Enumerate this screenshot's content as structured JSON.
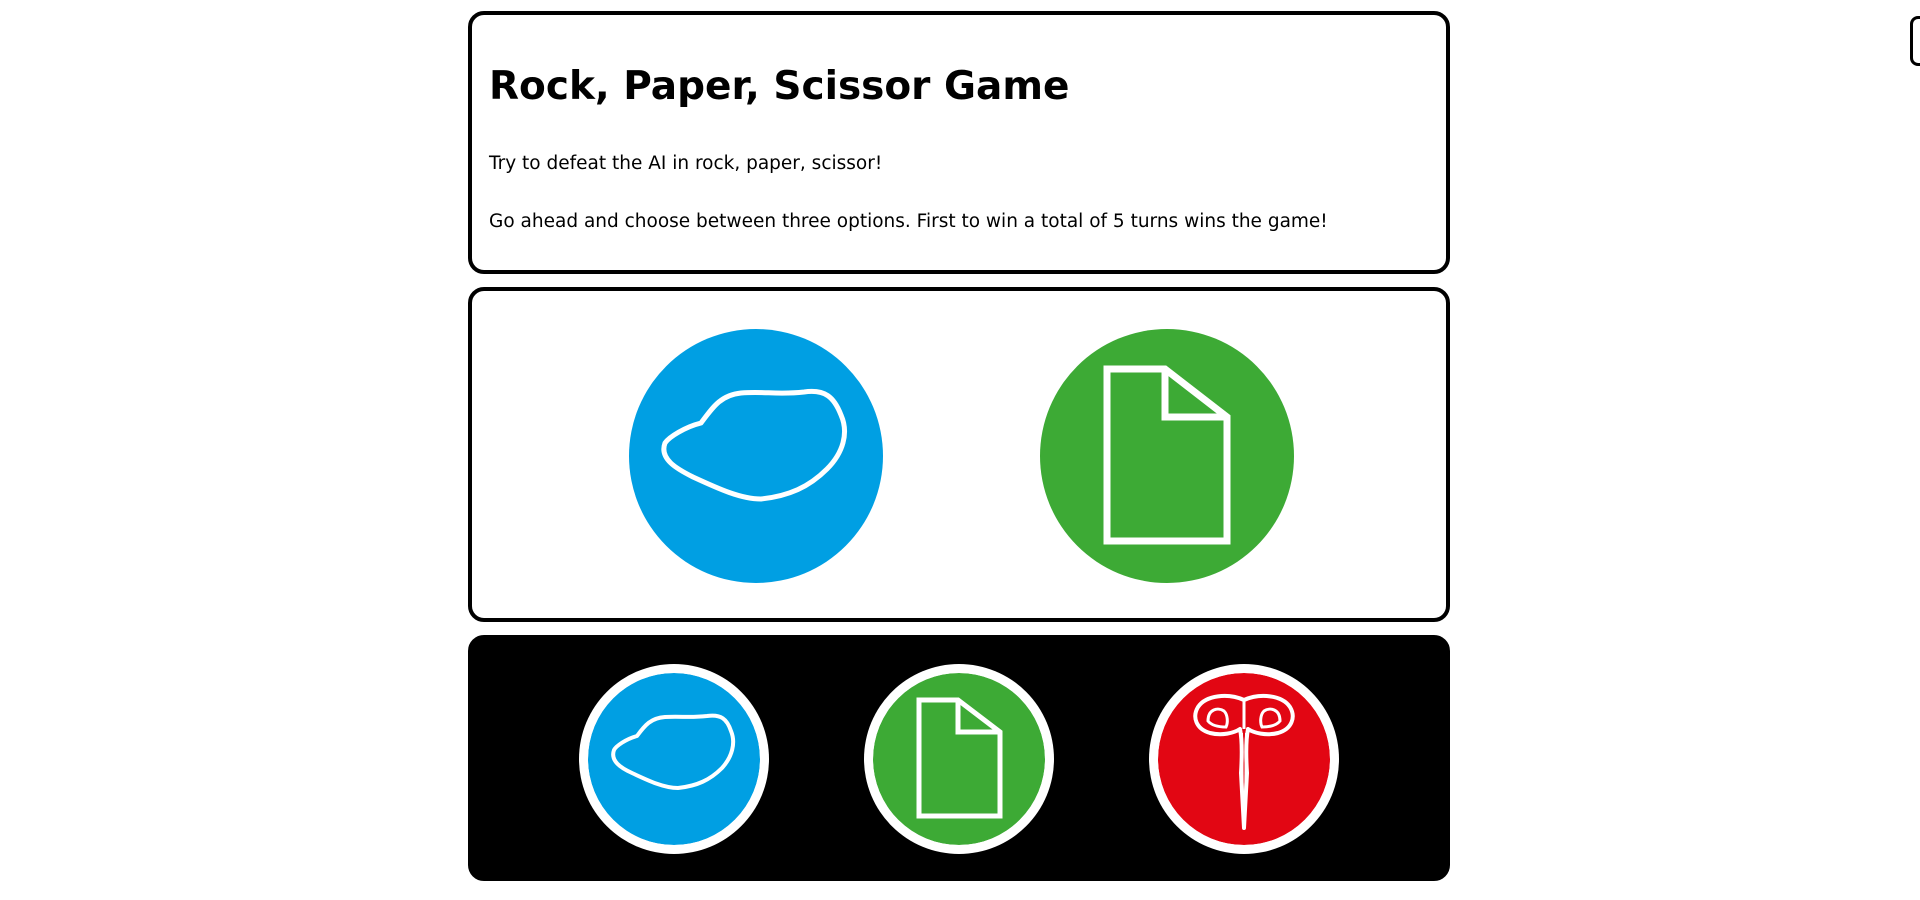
{
  "intro": {
    "title": "Rock, Paper, Scissor Game",
    "line1": "Try to defeat the AI in rock, paper, scissor!",
    "line2": "Go ahead and choose between three options. First to win a total of 5 turns wins the game!"
  },
  "arena": {
    "player_choice": {
      "name": "rock",
      "icon": "rock-icon",
      "color": "#009FE3"
    },
    "ai_choice": {
      "name": "paper",
      "icon": "paper-icon",
      "color": "#3DAA35"
    }
  },
  "controls": {
    "options": [
      {
        "name": "rock",
        "icon": "rock-icon",
        "color": "#009FE3"
      },
      {
        "name": "paper",
        "icon": "paper-icon",
        "color": "#3DAA35"
      },
      {
        "name": "scissor",
        "icon": "scissor-icon",
        "color": "#E20613"
      }
    ]
  }
}
